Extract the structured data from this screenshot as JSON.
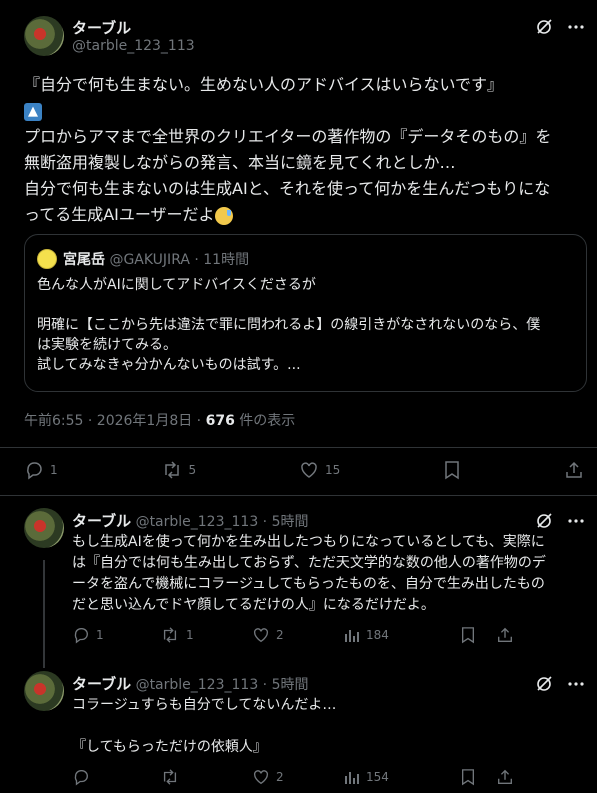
{
  "main_tweet": {
    "name": "ターブル",
    "handle": "@tarble_123_113",
    "lines": [
      "『自分で何も生まない。生めない人のアドバイスはいらないです』",
      "プロからアマまで全世界のクリエイターの著作物の『データそのもの』を",
      "無断盗用複製しながらの発言、本当に鏡を見てくれとしか…",
      "自分で何も生まないのは生成AIと、それを使って何かを生んだつもりにな",
      "ってる生成AIユーザーだよ"
    ],
    "meta_time": "午前6:55 · 2026年1月8日 · ",
    "meta_views": "676",
    "meta_views_label": " 件の表示",
    "replies": "1",
    "reposts": "5",
    "likes": "15"
  },
  "quote": {
    "name": "宮尾岳",
    "handle_time": "@GAKUJIRA · 11時間",
    "lines": [
      "色んな人がAIに関してアドバイスくださるが",
      "",
      "明確に【ここから先は違法で罪に問われるよ】の線引きがなされないのなら、僕",
      "は実験を続けてみる。",
      "試してみなきゃ分かんないものは試す。..."
    ]
  },
  "reply1": {
    "name": "ターブル",
    "handle_time": "@tarble_123_113 · 5時間",
    "lines": [
      "もし生成AIを使って何かを生み出したつもりになっているとしても、実際に",
      "は『自分では何も生み出しておらず、ただ天文学的な数の他人の著作物のデ",
      "ータを盗んで機械にコラージュしてもらったものを、自分で生み出したもの",
      "だと思い込んでドヤ顔してるだけの人』になるだけだよ。"
    ],
    "replies": "1",
    "reposts": "1",
    "likes": "2",
    "views": "184"
  },
  "reply2": {
    "name": "ターブル",
    "handle_time": "@tarble_123_113 · 5時間",
    "lines": [
      "コラージュすらも自分でしてないんだよ…",
      "",
      "『してもらっただけの依頼人』"
    ],
    "replies": "",
    "reposts": "",
    "likes": "2",
    "views": "154"
  }
}
